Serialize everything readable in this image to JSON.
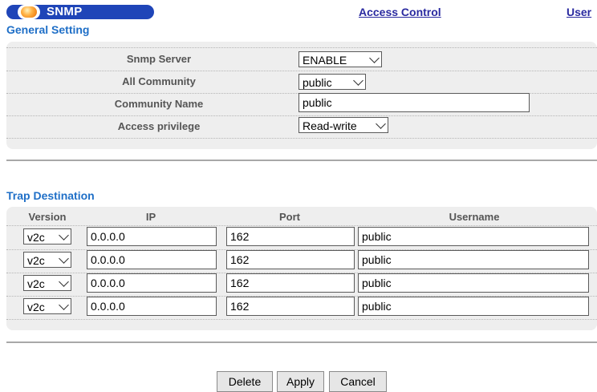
{
  "header": {
    "title": "SNMP",
    "links": [
      "Access Control",
      "User"
    ]
  },
  "general": {
    "title": "General Setting",
    "rows": [
      {
        "label": "Snmp Server",
        "value": "ENABLE"
      },
      {
        "label": "All Community",
        "value": "public"
      },
      {
        "label": "Community Name",
        "value": "public"
      },
      {
        "label": "Access privilege",
        "value": "Read-write"
      }
    ]
  },
  "trap": {
    "title": "Trap Destination",
    "headers": [
      "Version",
      "IP",
      "Port",
      "Username"
    ],
    "rows": [
      {
        "version": "v2c",
        "ip": "0.0.0.0",
        "port": "162",
        "username": "public"
      },
      {
        "version": "v2c",
        "ip": "0.0.0.0",
        "port": "162",
        "username": "public"
      },
      {
        "version": "v2c",
        "ip": "0.0.0.0",
        "port": "162",
        "username": "public"
      },
      {
        "version": "v2c",
        "ip": "0.0.0.0",
        "port": "162",
        "username": "public"
      }
    ]
  },
  "buttons": {
    "delete": "Delete",
    "apply": "Apply",
    "cancel": "Cancel"
  },
  "colors": {
    "pill": "#1f45b8",
    "section_title": "#1f6fc7",
    "link": "#2a2aa0",
    "panel": "#eeeeee"
  }
}
